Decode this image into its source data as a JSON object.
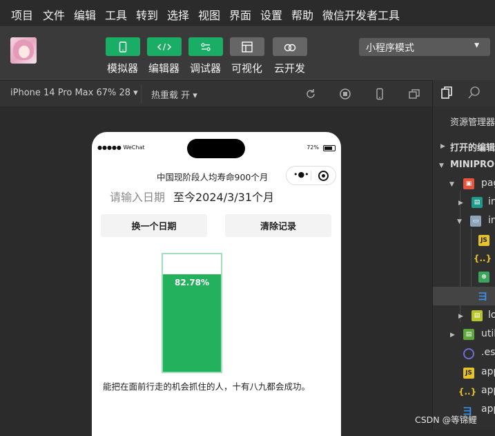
{
  "menu": [
    "项目",
    "文件",
    "编辑",
    "工具",
    "转到",
    "选择",
    "视图",
    "界面",
    "设置",
    "帮助",
    "微信开发者工具"
  ],
  "toolbar": {
    "buttons": [
      {
        "label": "模拟器",
        "icon": "phone-icon"
      },
      {
        "label": "编辑器",
        "icon": "code-icon"
      },
      {
        "label": "调试器",
        "icon": "debug-icon"
      },
      {
        "label": "可视化",
        "icon": "layout-icon"
      },
      {
        "label": "云开发",
        "icon": "cloud-icon"
      }
    ],
    "mode": "小程序模式"
  },
  "simulator_bar": {
    "device": "iPhone 14 Pro Max 67% 28",
    "device_arrow": "▾",
    "hot_reload": "热重载 开",
    "hot_reload_arrow": "▾"
  },
  "phone": {
    "carrier": "●●●●● WeChat",
    "battery": "72%",
    "capsule_dots": "•●•",
    "life_text": "中国现阶段人均寿命900个月",
    "date_placeholder": "请输入日期",
    "date_result": "至今2024/3/31个月",
    "btn_change": "换一个日期",
    "btn_clear": "清除记录",
    "progress_percent": 82.78,
    "progress_label": "82.78%",
    "quote": "能把在面前行走的机会抓住的人，十有八九都会成功。"
  },
  "explorer": {
    "title": "资源管理器",
    "open_editors": "打开的编辑",
    "project": "MINIPROG",
    "items": [
      {
        "label": "pag",
        "icon": "folder-pages-icon"
      },
      {
        "label": "in",
        "icon": "folder-index-icon"
      },
      {
        "label": "in",
        "icon": "folder-open-icon"
      },
      {
        "label": "JS",
        "icon": "js-file-icon"
      },
      {
        "label": "{..}",
        "icon": "json-file-icon"
      },
      {
        "label": "",
        "icon": "wxml-file-icon"
      },
      {
        "label": "",
        "icon": "css-file-icon"
      },
      {
        "label": "lo",
        "icon": "folder-logs-icon"
      },
      {
        "label": "util",
        "icon": "folder-utils-icon"
      },
      {
        "label": ".esl",
        "icon": "eslint-file-icon"
      },
      {
        "label": "app",
        "icon": "js-file-icon"
      },
      {
        "label": "app",
        "icon": "json-file-icon"
      },
      {
        "label": "app",
        "icon": "css-file-icon"
      }
    ]
  },
  "watermark": "CSDN @等锦鲤",
  "colors": {
    "accent_green": "#1aad65",
    "progress_green": "#24b15e",
    "progress_border": "#9fe0bb"
  }
}
